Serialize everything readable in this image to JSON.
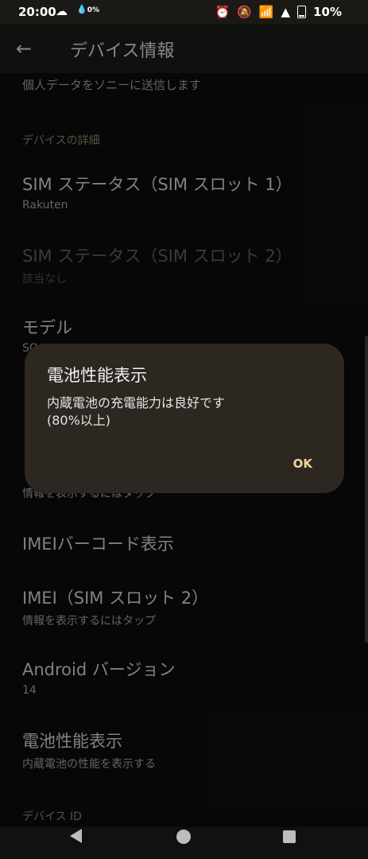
{
  "status": {
    "time": "20:00",
    "rain_percent": "0%",
    "battery": "10%"
  },
  "app_bar": {
    "title": "デバイス情報"
  },
  "list": {
    "partial_top": "個人データをソニーに送信します",
    "section_details": "デバイスの詳細",
    "sim1": {
      "title": "SIM ステータス（SIM スロット 1）",
      "subtitle": "Rakuten"
    },
    "sim2": {
      "title": "SIM ステータス（SIM スロット 2）",
      "subtitle": "該当なし"
    },
    "model": {
      "title": "モデル",
      "subtitle": "SO"
    },
    "hidden_row_sub": "情報を表示するにはタップ",
    "imei_barcode": {
      "title": "IMEIバーコード表示"
    },
    "imei2": {
      "title": "IMEI（SIM スロット 2）",
      "subtitle": "情報を表示するにはタップ"
    },
    "android": {
      "title": "Android バージョン",
      "subtitle": "14"
    },
    "battery": {
      "title": "電池性能表示",
      "subtitle": "内蔵電池の性能を表示する"
    },
    "section_device_id": "デバイス ID"
  },
  "dialog": {
    "title": "電池性能表示",
    "body_line1": "内蔵電池の充電能力は良好です",
    "body_line2": "(80%以上)",
    "ok_label": "OK"
  },
  "icons": {
    "back": "arrow-left",
    "weather": "cloud-sun",
    "rain": "rain-drop",
    "alarm": "alarm-clock",
    "mute": "vibrate-off",
    "wifi": "wifi",
    "signal": "cell-signal",
    "battery": "battery"
  }
}
